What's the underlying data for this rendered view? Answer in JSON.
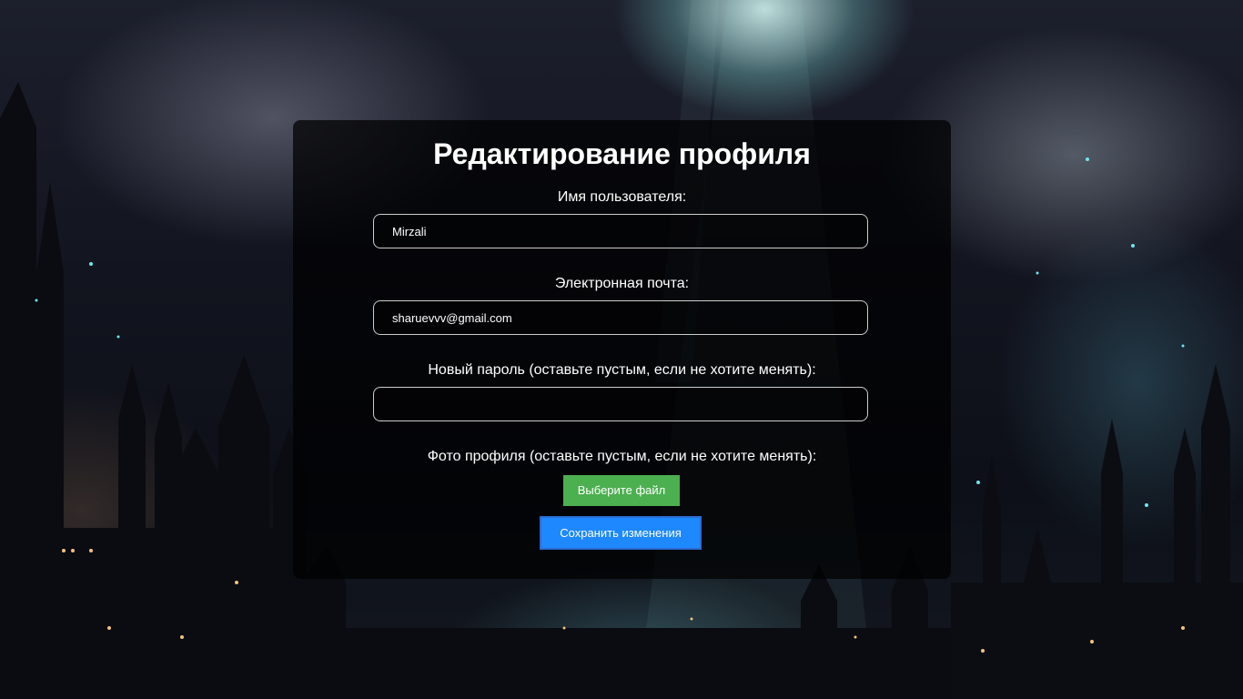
{
  "page": {
    "title": "Редактирование профиля"
  },
  "form": {
    "username": {
      "label": "Имя пользователя:",
      "value": "Mirzali"
    },
    "email": {
      "label": "Электронная почта:",
      "value": "sharuevvv@gmail.com"
    },
    "password": {
      "label": "Новый пароль (оставьте пустым, если не хотите менять):",
      "value": ""
    },
    "photo": {
      "label": "Фото профиля (оставьте пустым, если не хотите менять):",
      "button_label": "Выберите файл"
    },
    "submit_label": "Сохранить изменения"
  },
  "colors": {
    "file_button": "#4caf50",
    "save_button": "#1e88ff",
    "card_background": "rgba(0,0,0,0.72)"
  },
  "background": {
    "description_icon": "fantasy-castle-background"
  }
}
